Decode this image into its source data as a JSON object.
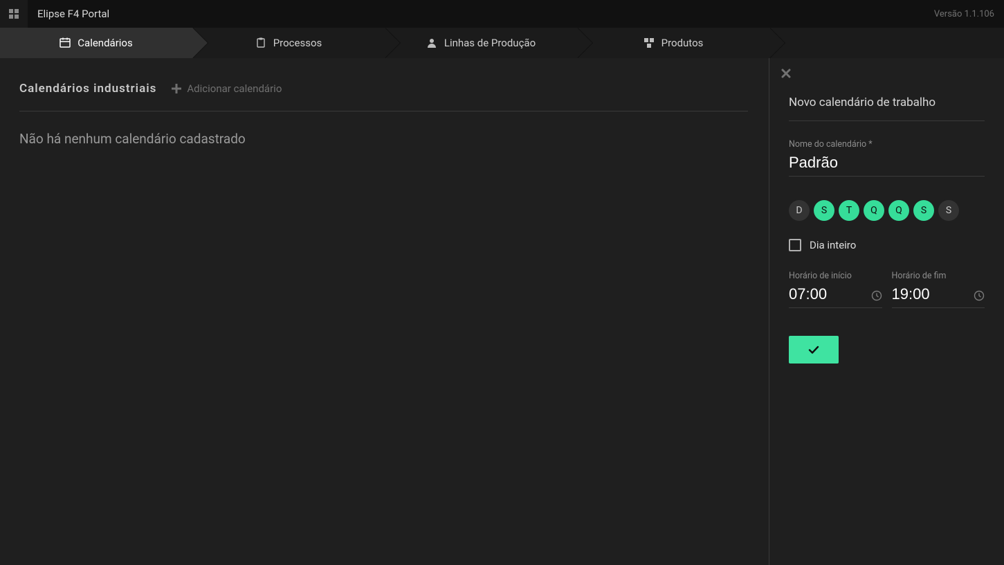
{
  "header": {
    "title": "Elipse F4 Portal",
    "version": "Versão 1.1.106"
  },
  "nav": {
    "tabs": [
      {
        "label": "Calendários",
        "icon": "calendar-icon",
        "active": true
      },
      {
        "label": "Processos",
        "icon": "clipboard-icon",
        "active": false
      },
      {
        "label": "Linhas de Produção",
        "icon": "person-icon",
        "active": false
      },
      {
        "label": "Produtos",
        "icon": "package-icon",
        "active": false
      }
    ]
  },
  "main": {
    "section_title": "Calendários industriais",
    "add_label": "Adicionar calendário",
    "empty_message": "Não há nenhum calendário cadastrado"
  },
  "panel": {
    "title": "Novo calendário de trabalho",
    "name_label": "Nome do calendário *",
    "name_value": "Padrão",
    "days": [
      {
        "letter": "D",
        "selected": false
      },
      {
        "letter": "S",
        "selected": true
      },
      {
        "letter": "T",
        "selected": true
      },
      {
        "letter": "Q",
        "selected": true
      },
      {
        "letter": "Q",
        "selected": true
      },
      {
        "letter": "S",
        "selected": true
      },
      {
        "letter": "S",
        "selected": false
      }
    ],
    "all_day_label": "Dia inteiro",
    "all_day_checked": false,
    "start_label": "Horário de início",
    "start_value": "07:00",
    "end_label": "Horário de fim",
    "end_value": "19:00"
  },
  "colors": {
    "accent": "#36dd99",
    "bg": "#1f1f1f"
  }
}
